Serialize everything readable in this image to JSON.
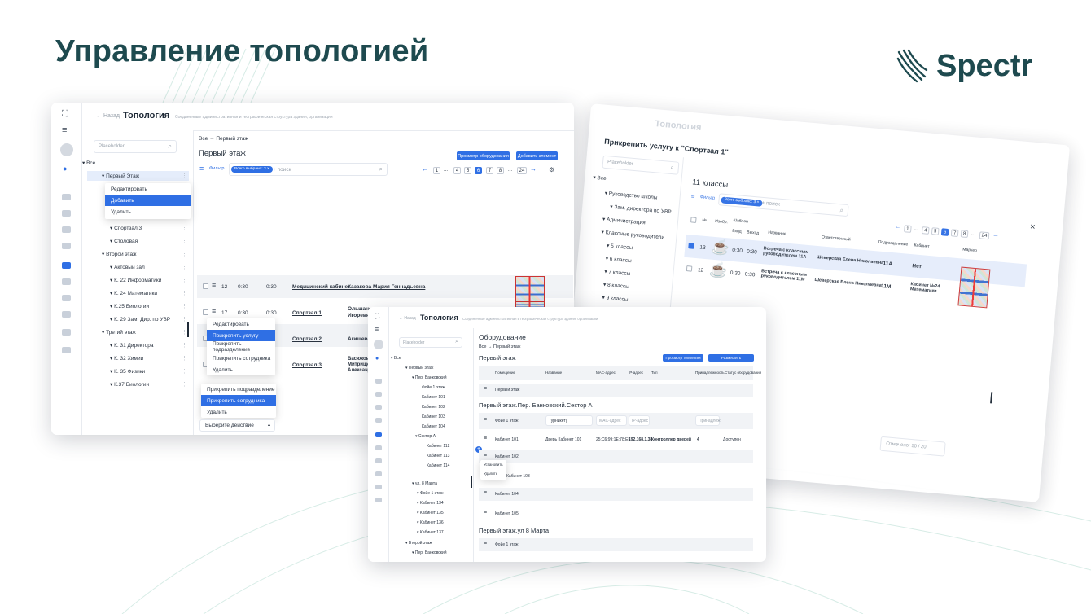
{
  "slide": {
    "title": "Управление топологией",
    "brand": "Spectr",
    "colors": {
      "accent": "#2f6fe4",
      "brand": "#1e4a4f"
    }
  },
  "w1": {
    "back": "← Назад",
    "title": "Топология",
    "subtitle": "Соединенные административная и географическая структура здания, организации",
    "search_placeholder": "Placeholder",
    "tree": [
      "Все",
      "Первый Этаж",
      "Спортзал 3",
      "Столовая",
      "Второй этаж",
      "Актовый зал",
      "К. 22 Информатики",
      "К. 24 Математики",
      "К.25 Биологии",
      "К. 29 Зам. Дир. по УВР",
      "Третий этаж",
      "К. 31 Директора",
      "К. 32 Химии",
      "К. 35 Физики",
      "К.37 Биологии"
    ],
    "ctx_menu": [
      "Редактировать",
      "Добавить",
      "Удалить"
    ],
    "breadcrumb": [
      "Все",
      "Первый этаж"
    ],
    "heading": "Первый этаж",
    "btn_view": "Просмотр оборудования",
    "btn_add": "Добавить элемент",
    "filter": "Фильтр",
    "chip": "Всего выбрано: 3 ×",
    "search": "+ поиск",
    "pages": [
      "1",
      "...",
      "4",
      "5",
      "6",
      "7",
      "8",
      "...",
      "24"
    ],
    "rows": [
      {
        "n": "12",
        "in": "0:30",
        "out": "0:30",
        "name": "Медицинский кабинет",
        "person": "Казакова Мария Геннадьевна"
      },
      {
        "n": "17",
        "in": "0:30",
        "out": "0:30",
        "name": "Спортзал 1",
        "person": "Ольшанс Игоревн"
      },
      {
        "n": "",
        "in": "",
        "out": "",
        "name": "Спортзал 2",
        "person": "Агишева С"
      },
      {
        "n": "",
        "in": "",
        "out": "",
        "name": "Спортзал 3",
        "person": "Васюков Митрищен Александ"
      }
    ],
    "row_menu": [
      "Редактировать",
      "Прикрепить услугу",
      "Прикрепить подразделение",
      "Прикрепить сотрудника",
      "Удалить"
    ],
    "bottom_menu": [
      "Прикрепить подразделение",
      "Прикрепить сотрудника",
      "Удалить"
    ],
    "action_select": "Выберите действие"
  },
  "w2": {
    "title": "Топология",
    "dialog_title": "Прикрепить услугу к \"Спортзал 1\"",
    "search_placeholder": "Placeholder",
    "tree": [
      "Все",
      "Руководство школы",
      "Зам. директора по УВР",
      "Администрация",
      "Классные руководители",
      "5 классы",
      "6 классы",
      "7 классы",
      "8 классы",
      "9 классы"
    ],
    "heading": "11 классы",
    "filter": "Фильтр",
    "chip": "Всего выбрано: 3 ×",
    "search": "+ поиск",
    "cols": [
      "№",
      "Изобр.",
      "Шаблон",
      "Вход",
      "Выход",
      "Название",
      "Ответственный",
      "Подразделение",
      "Кабинет",
      "Маркер"
    ],
    "rows": [
      {
        "n": "13",
        "in": "0:30",
        "out": "0:30",
        "name": "Встреча с классным руководителем 11А",
        "person": "Шеверская Елена Николаевна",
        "dept": "11А",
        "room": "Нет"
      },
      {
        "n": "12",
        "in": "0:30",
        "out": "0:30",
        "name": "Встреча с классным руководителем 11М",
        "person": "Шеверская Елена Николаевна",
        "dept": "11М",
        "room": "Кабинет №24 Математики"
      }
    ],
    "pages": [
      "1",
      "...",
      "4",
      "5",
      "6",
      "7",
      "8",
      "...",
      "24"
    ],
    "selected": "Отмечено: 10 / 20"
  },
  "w3": {
    "back": "← Назад",
    "title": "Топология",
    "subtitle": "Соединенные административная и географическая структура здания, организации",
    "search_placeholder": "Placeholder",
    "tree": [
      "Все",
      "Первый этаж",
      "Пер. Банковский",
      "Фойе 1 этаж",
      "Кабинет 101",
      "Кабинет 102",
      "Кабинет 103",
      "Кабинет 104",
      "Сектор А",
      "Кабинет 112",
      "Кабинет 113",
      "Кабинет 114",
      "ул. 8 Марта",
      "Фойе 1 этаж",
      "Кабинет 134",
      "Кабинет 135",
      "Кабинет 136",
      "Кабинет 137",
      "Второй этаж",
      "Пер. Банковский"
    ],
    "heading": "Оборудование",
    "breadcrumb": [
      "Все",
      "Первый этаж"
    ],
    "section1": "Первый этаж",
    "btn_view": "Просмотр топологии",
    "btn_place": "Разместить",
    "cols": [
      "Помещение",
      "Название",
      "MAC-адрес",
      "IP-адрес",
      "Тип",
      "Принадлежность",
      "Статус оборудования"
    ],
    "s1_row": "Первый этаж",
    "section2": "Первый этаж.Пер. Банковский.Сектор А",
    "foyer": "Фойе 1 этаж",
    "turnstile": "Турникет|",
    "mac_ph": "MAC-адрес",
    "ip_ph": "IP-адрес",
    "aff_ph": "Принадлеж",
    "k101": {
      "room": "Кабинет 101",
      "name": "Дверь Кабинет 101",
      "mac": "25:C6:99:1E:78:EF",
      "ip": "192.168.1.38",
      "type": "Контроллер дверей",
      "aff": "4",
      "status": "Доступен"
    },
    "rooms": [
      "Кабинет 102",
      "Кабинет 103",
      "Кабинет 104",
      "Кабинет 105"
    ],
    "ctx": [
      "Установить",
      "Удалить"
    ],
    "section3": "Первый этаж.ул 8 Марта",
    "last_row": "Фойе 1 этаж"
  }
}
